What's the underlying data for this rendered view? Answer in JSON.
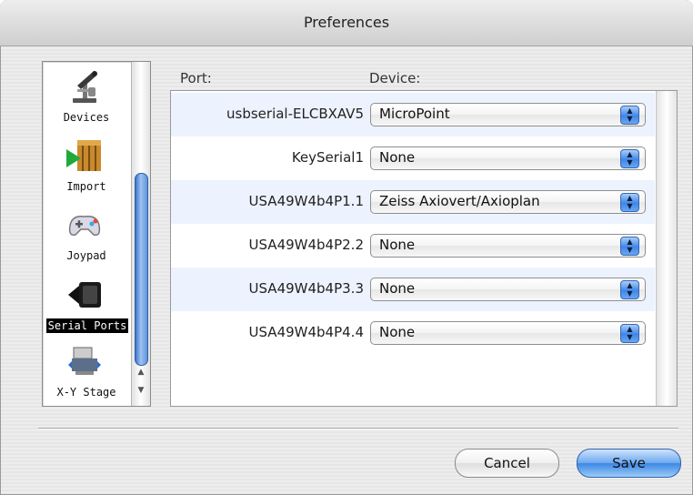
{
  "window": {
    "title": "Preferences"
  },
  "sidebar": {
    "items": [
      {
        "label": "Devices",
        "icon": "microscope-icon",
        "selected": false
      },
      {
        "label": "Import",
        "icon": "import-icon",
        "selected": false
      },
      {
        "label": "Joypad",
        "icon": "joypad-icon",
        "selected": false
      },
      {
        "label": "Serial Ports",
        "icon": "serial-port-icon",
        "selected": true
      },
      {
        "label": "X-Y Stage",
        "icon": "xy-stage-icon",
        "selected": false
      }
    ]
  },
  "table": {
    "headers": {
      "port": "Port:",
      "device": "Device:"
    },
    "rows": [
      {
        "port": "usbserial-ELCBXAV5",
        "device": "MicroPoint"
      },
      {
        "port": "KeySerial1",
        "device": "None"
      },
      {
        "port": "USA49W4b4P1.1",
        "device": "Zeiss Axiovert/Axioplan"
      },
      {
        "port": "USA49W4b4P2.2",
        "device": "None"
      },
      {
        "port": "USA49W4b4P3.3",
        "device": "None"
      },
      {
        "port": "USA49W4b4P4.4",
        "device": "None"
      }
    ]
  },
  "buttons": {
    "cancel": "Cancel",
    "save": "Save"
  },
  "colors": {
    "accent": "#3c87e5",
    "alt_row": "#edf3fe",
    "selection": "#000000"
  }
}
